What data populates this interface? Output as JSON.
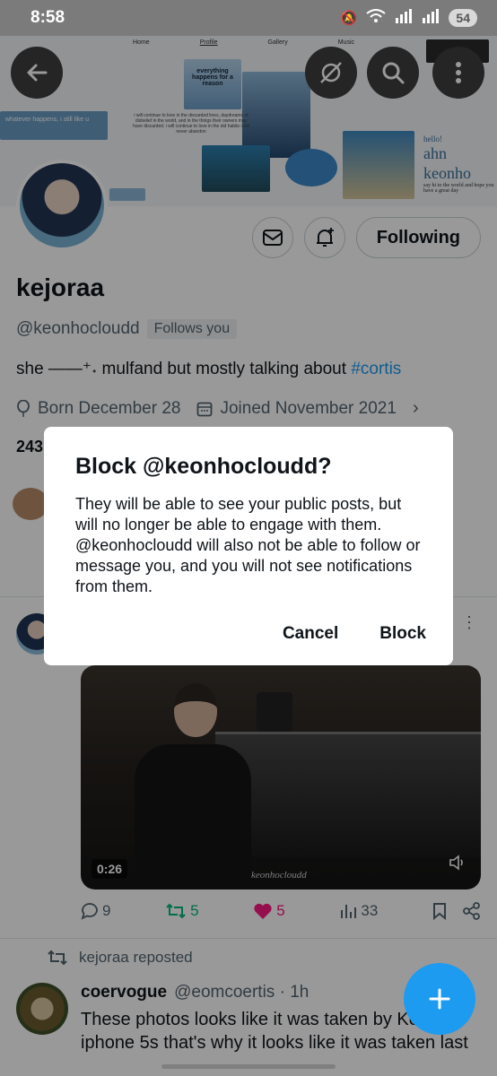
{
  "status_bar": {
    "time": "8:58",
    "battery": "54"
  },
  "banner": {
    "nav": [
      "Home",
      "Profile",
      "Gallery",
      "Music"
    ],
    "tagline": "whatever happens, i still like u",
    "note": "everything happens for a reason",
    "poem": "i will continue to love in the discarded lines, daydreams of disbelief in the world, and in the things their owners may have discarded. i will continue to love in the old habits i will never abandon",
    "hello": "hello!",
    "ahn": "ahn keonho",
    "sayhi": "say hi to the world and hope you have a great day"
  },
  "profile": {
    "name": "kejoraa",
    "handle": "@keonhocloudd",
    "follows_you": "Follows you",
    "bio_text": "she ——⁺˖ mulfand but mostly talking about",
    "bio_tag": "#cortis",
    "born": "Born December 28",
    "joined": "Joined November 2021",
    "stats_partial": "243",
    "following_label": "Following"
  },
  "post": {
    "duration": "0:26",
    "watermark": "keonhocloudd",
    "replies": "9",
    "reposts": "5",
    "likes": "5",
    "views": "33"
  },
  "repost": {
    "label": "kejoraa reposted",
    "username": "coervogue",
    "handle_time": "@eomcoertis · 1h",
    "text": "These photos looks like it was taken by Ke iphone 5s that's why it looks like it was taken last"
  },
  "dialog": {
    "title": "Block @keonhocloudd?",
    "body": "They will be able to see your public posts, but will no longer be able to engage with them. @keonhocloudd will also not be able to follow or message you, and you will not see notifications from them.",
    "cancel": "Cancel",
    "confirm": "Block"
  },
  "colors": {
    "accent": "#1d9bf0",
    "like": "#f91880",
    "repost": "#00ba7c"
  }
}
